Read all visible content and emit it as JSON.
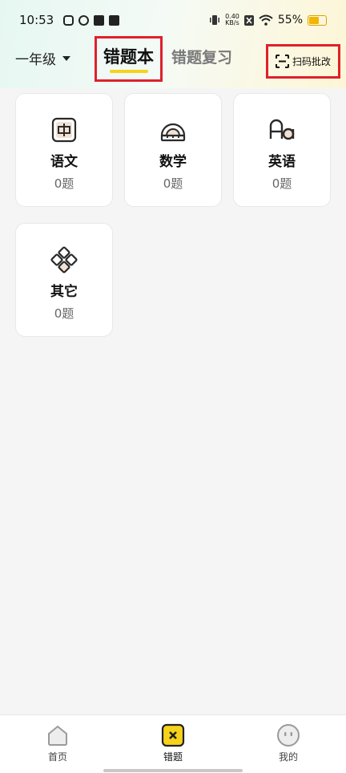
{
  "status_bar": {
    "time": "10:53",
    "speed_value": "0.40",
    "speed_unit": "KB/s",
    "battery": "55%"
  },
  "header": {
    "grade": "一年级",
    "tab_active": "错题本",
    "tab_other": "错题复习",
    "scan_label": "扫码批改"
  },
  "subjects": [
    {
      "name": "语文",
      "count": "0题",
      "icon": "chinese-char-icon"
    },
    {
      "name": "数学",
      "count": "0题",
      "icon": "protractor-icon"
    },
    {
      "name": "英语",
      "count": "0题",
      "icon": "letters-aa-icon"
    },
    {
      "name": "其它",
      "count": "0题",
      "icon": "diamond-grid-icon"
    }
  ],
  "bottom_nav": {
    "items": [
      {
        "label": "首页",
        "icon": "home-icon"
      },
      {
        "label": "错题",
        "icon": "wrong-question-icon"
      },
      {
        "label": "我的",
        "icon": "profile-icon"
      }
    ]
  },
  "colors": {
    "accent_yellow": "#f7d21a",
    "highlight_red": "#e0202b"
  }
}
